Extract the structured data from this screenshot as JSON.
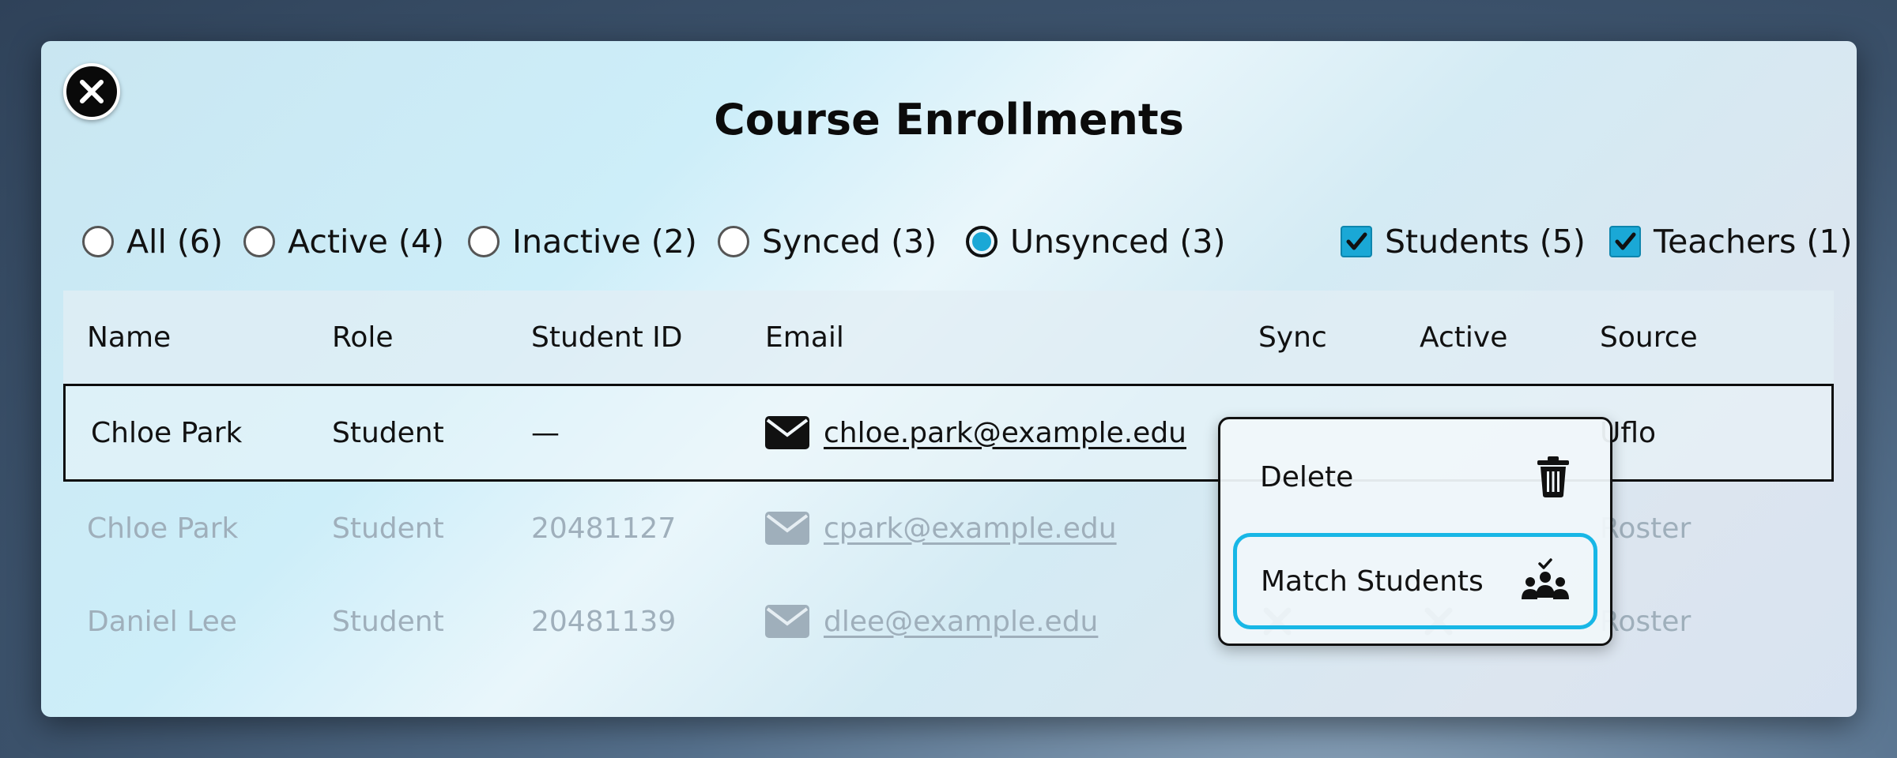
{
  "dialog": {
    "title": "Course Enrollments",
    "close_icon": "close-icon"
  },
  "filters": {
    "radios": [
      {
        "label": "All (6)",
        "selected": false
      },
      {
        "label": "Active (4)",
        "selected": false
      },
      {
        "label": "Inactive (2)",
        "selected": false
      },
      {
        "label": "Synced (3)",
        "selected": false
      },
      {
        "label": "Unsynced (3)",
        "selected": true
      }
    ],
    "checkboxes": [
      {
        "label": "Students (5)",
        "checked": true
      },
      {
        "label": "Teachers (1)",
        "checked": true
      }
    ]
  },
  "table": {
    "columns": [
      "Name",
      "Role",
      "Student ID",
      "Email",
      "Sync",
      "Active",
      "Source"
    ],
    "rows": [
      {
        "name": "Chloe Park",
        "role": "Student",
        "student_id": "—",
        "email": "chloe.park@example.edu",
        "source": "Uflo",
        "selected": true
      },
      {
        "name": "Chloe Park",
        "role": "Student",
        "student_id": "20481127",
        "email": "cpark@example.edu",
        "source": "Roster",
        "selected": false
      },
      {
        "name": "Daniel Lee",
        "role": "Student",
        "student_id": "20481139",
        "email": "dlee@example.edu",
        "sync_icon": "x-icon",
        "active_icon": "x-icon",
        "source": "Roster",
        "selected": false
      }
    ]
  },
  "context_menu": {
    "items": [
      {
        "label": "Delete",
        "icon": "trash-icon"
      },
      {
        "label": "Match Students",
        "icon": "match-students-icon",
        "highlighted": true
      }
    ]
  },
  "colors": {
    "accent": "#1aa8d6",
    "highlight_border": "#18b7e6",
    "dim_text": "#9fafbb"
  }
}
